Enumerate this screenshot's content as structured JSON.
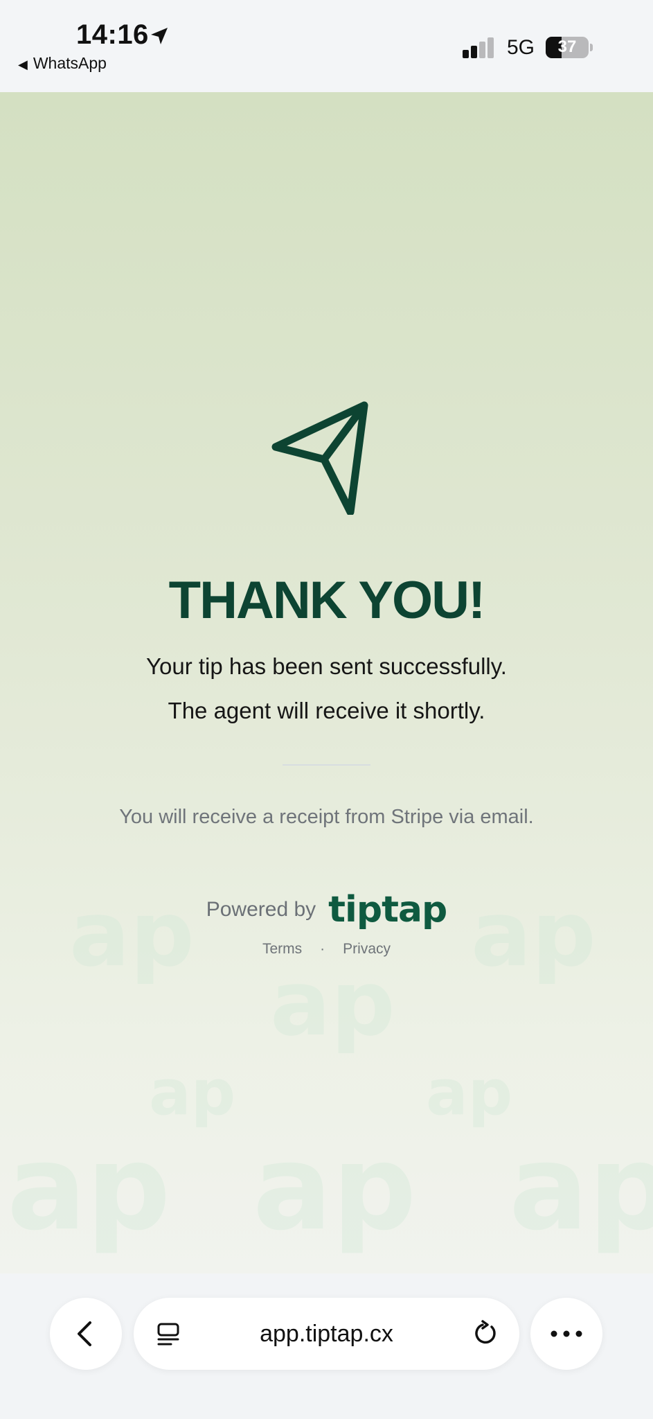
{
  "status_bar": {
    "time": "14:16",
    "back_app": "WhatsApp",
    "network": "5G",
    "battery": "37",
    "battery_fraction": 0.37
  },
  "main": {
    "title": "THANK YOU!",
    "line1": "Your tip has been sent successfully.",
    "line2": "The agent will receive it shortly.",
    "receipt_note": "You will receive a receipt from Stripe via email.",
    "powered_by": "Powered by",
    "brand": "tiptap",
    "links": {
      "terms": "Terms",
      "separator": "·",
      "privacy": "Privacy"
    },
    "watermark_text": "ap"
  },
  "browser": {
    "url": "app.tiptap.cx",
    "icons": [
      "back-chevron-icon",
      "tabs-icon",
      "reload-icon",
      "more-icon"
    ]
  },
  "colors": {
    "accent": "#0d4432",
    "brand": "#0f5a40",
    "gradient_top": "#d4e0c2",
    "gradient_bottom": "#f1f3ee"
  }
}
